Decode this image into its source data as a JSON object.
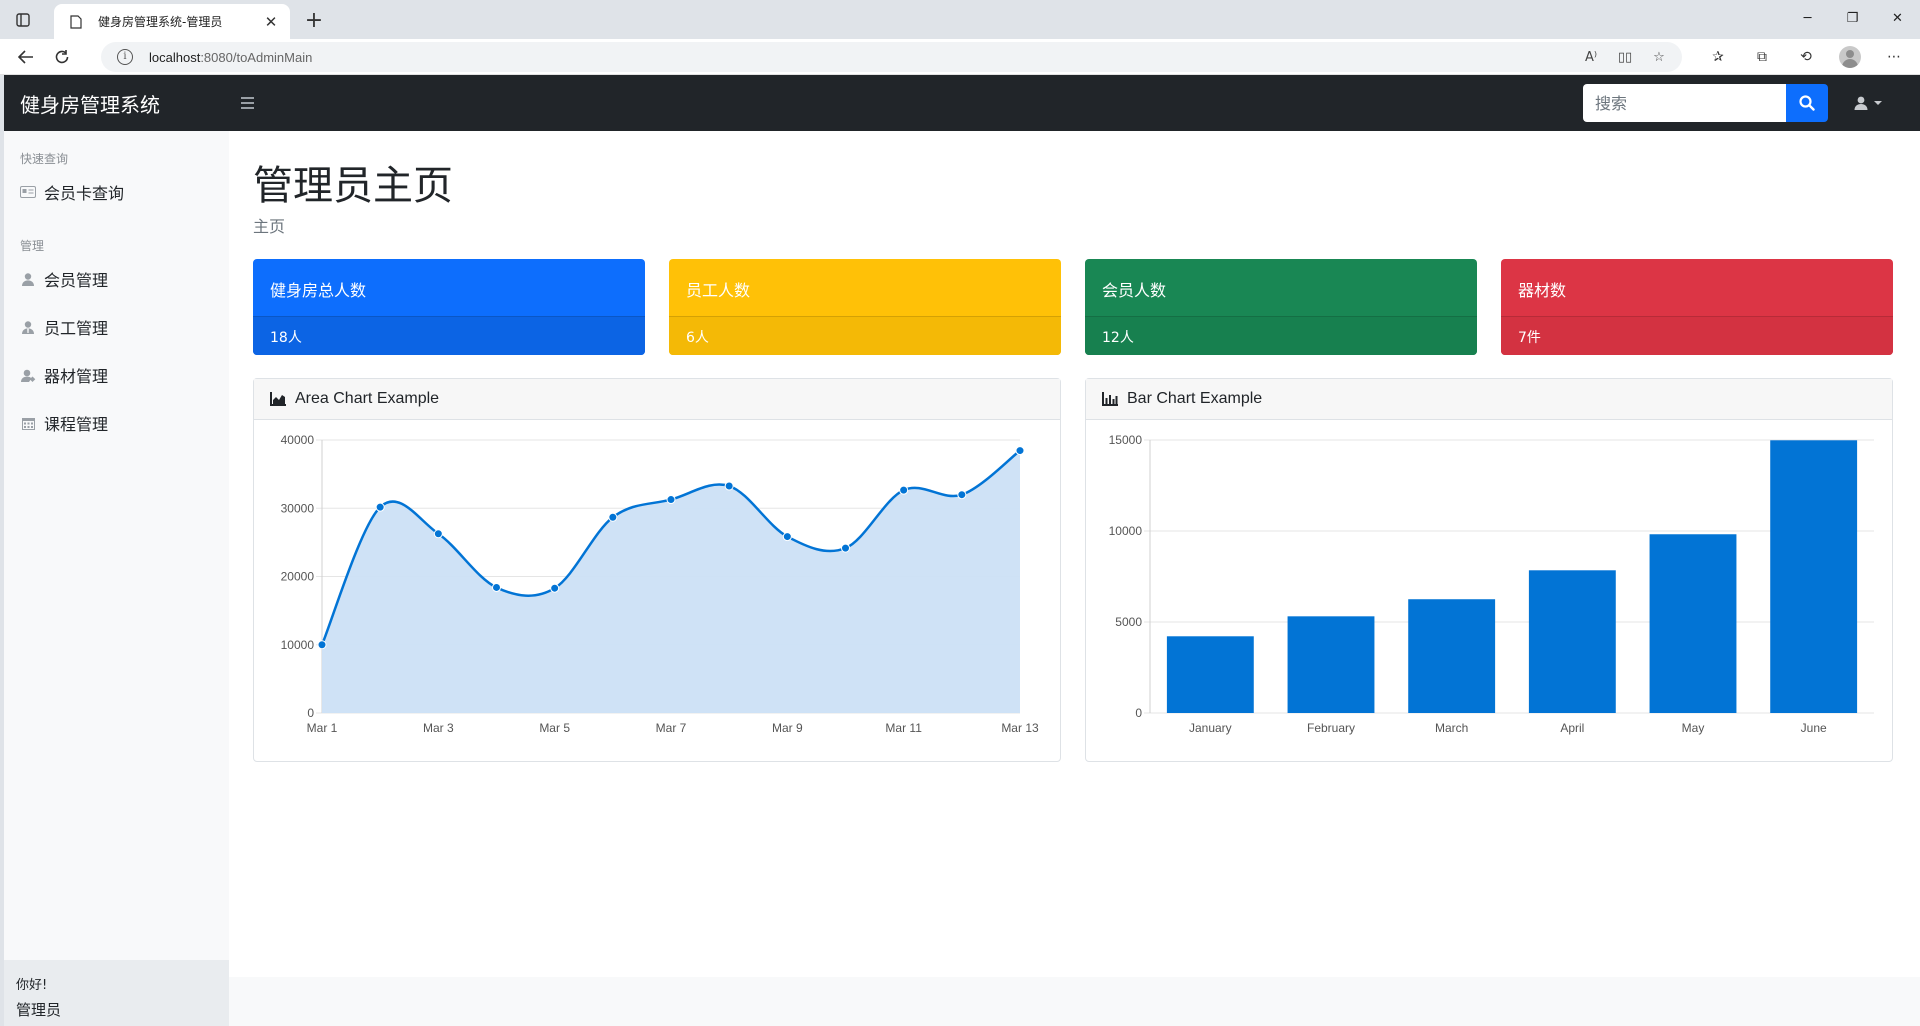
{
  "browser": {
    "tab_title": "健身房管理系统-管理员",
    "new_tab": "+",
    "url_host": "localhost",
    "url_path": ":8080/toAdminMain"
  },
  "navbar": {
    "brand": "健身房管理系统",
    "search_placeholder": "搜索"
  },
  "sidebar": {
    "section_quick": "快速查询",
    "item_card": "会员卡查询",
    "section_manage": "管理",
    "items": [
      {
        "label": "会员管理",
        "icon": "user-icon"
      },
      {
        "label": "员工管理",
        "icon": "user-tie-icon"
      },
      {
        "label": "器材管理",
        "icon": "equipment-icon"
      },
      {
        "label": "课程管理",
        "icon": "calendar-icon"
      }
    ],
    "footer_greeting": "你好!",
    "footer_role": "管理员"
  },
  "page": {
    "title": "管理员主页",
    "breadcrumb": "主页"
  },
  "stats": [
    {
      "label": "健身房总人数",
      "value": "18人",
      "color": "#0d6efd"
    },
    {
      "label": "员工人数",
      "value": "6人",
      "color": "#ffc107"
    },
    {
      "label": "会员人数",
      "value": "12人",
      "color": "#198754"
    },
    {
      "label": "器材数",
      "value": "7件",
      "color": "#dc3545"
    }
  ],
  "chart_data": [
    {
      "type": "area",
      "title": "Area Chart Example",
      "x": [
        "Mar 1",
        "Mar 2",
        "Mar 3",
        "Mar 4",
        "Mar 5",
        "Mar 6",
        "Mar 7",
        "Mar 8",
        "Mar 9",
        "Mar 10",
        "Mar 11",
        "Mar 12",
        "Mar 13"
      ],
      "x_tick_labels": [
        "Mar 1",
        "Mar 3",
        "Mar 5",
        "Mar 7",
        "Mar 9",
        "Mar 11",
        "Mar 13"
      ],
      "values": [
        10000,
        30162,
        26263,
        18394,
        18287,
        28682,
        31274,
        33259,
        25849,
        24159,
        32651,
        31984,
        38451
      ],
      "ylim": [
        0,
        40000
      ],
      "y_ticks": [
        0,
        10000,
        20000,
        30000,
        40000
      ],
      "grid": true,
      "line_color": "#0274d5",
      "fill_color": "#cce0f5"
    },
    {
      "type": "bar",
      "title": "Bar Chart Example",
      "categories": [
        "January",
        "February",
        "March",
        "April",
        "May",
        "June"
      ],
      "values": [
        4215,
        5312,
        6251,
        7841,
        9821,
        14984
      ],
      "ylim": [
        0,
        15000
      ],
      "y_ticks": [
        0,
        5000,
        10000,
        15000
      ],
      "grid": true,
      "bar_color": "#0274d5"
    }
  ]
}
